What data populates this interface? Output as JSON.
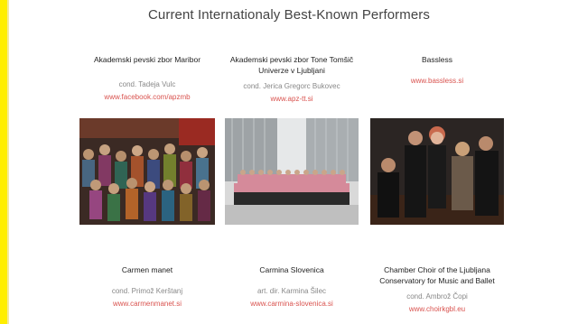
{
  "page": {
    "title": "Current Internationaly Best-Known Performers"
  },
  "performers_row1": [
    {
      "name": "Akademski pevski zbor Maribor",
      "name_line2": "",
      "conductor": "cond. Tadeja Vulc",
      "link": "www.facebook.com/apzmb"
    },
    {
      "name": "Akademski pevski zbor Tone Tomšič",
      "name_line2": "Univerze v Ljubljani",
      "conductor": "cond. Jerica Gregorc Bukovec",
      "link": "www.apz-tt.si"
    },
    {
      "name": "Bassless",
      "name_line2": "",
      "conductor": "",
      "link": "www.bassless.si"
    }
  ],
  "performers_row2": [
    {
      "name": "Carmen manet",
      "name_line2": "",
      "conductor": "cond. Primož Kerštanj",
      "link": "www.carmenmanet.si"
    },
    {
      "name": "Carmina Slovenica",
      "name_line2": "",
      "conductor": "art. dir. Karmina Šilec",
      "link": "www.carmina-slovenica.si"
    },
    {
      "name": "Chamber Choir of the Ljubljana",
      "name_line2": "Conservatory for Music and Ballet",
      "conductor": "cond. Ambrož Čopi",
      "link": "www.choirkgbl.eu"
    }
  ],
  "colors": {
    "accent_bar": "#ffee00",
    "link": "#d9534f"
  }
}
